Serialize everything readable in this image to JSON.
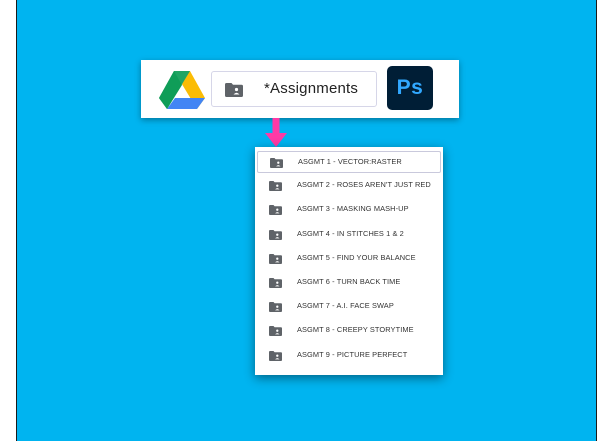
{
  "top_bar": {
    "app_left": "google-drive-logo",
    "breadcrumb_label": "*Assignments",
    "app_right_label": "Ps"
  },
  "folders": [
    {
      "label": "ASGMT 1 - VECTOR:RASTER",
      "selected": true
    },
    {
      "label": "ASGMT 2 - ROSES AREN'T JUST RED",
      "selected": false
    },
    {
      "label": "ASGMT 3 - MASKING MASH-UP",
      "selected": false
    },
    {
      "label": "ASGMT 4 - IN STITCHES 1 & 2",
      "selected": false
    },
    {
      "label": "ASGMT 5 - FIND YOUR BALANCE",
      "selected": false
    },
    {
      "label": "ASGMT 6 - TURN BACK TIME",
      "selected": false
    },
    {
      "label": "ASGMT 7 - A.I. FACE SWAP",
      "selected": false
    },
    {
      "label": "ASGMT 8 - CREEPY STORYTIME",
      "selected": false
    },
    {
      "label": "ASGMT 9 - PICTURE PERFECT",
      "selected": false
    }
  ],
  "colors": {
    "background": "#00b4f0",
    "arrow": "#ff3aa6",
    "ps_bg": "#001e36",
    "ps_text": "#31a8ff"
  }
}
